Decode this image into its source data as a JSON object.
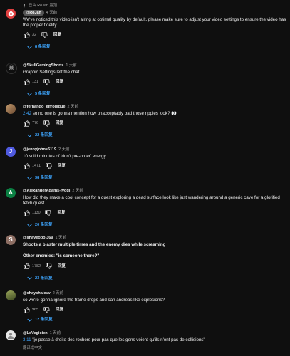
{
  "comments": [
    {
      "pinned_label": "已由 RoJan 置顶",
      "author": "@RoJan",
      "owner": true,
      "time": "4 天前",
      "text": "We've noticed this video isn't airing at optimal quality by default, please make sure to adjust your video settings to ensure the video has the proper fidelity.",
      "likes": "32",
      "reply_label": "回复",
      "replies": "8 条回复",
      "avatar_color": "#e04040",
      "avatar_letter": ""
    },
    {
      "author": "@SkullGamingShorts",
      "time": "1 天前",
      "text": "Graphic Settings left the chat...",
      "likes": "131",
      "reply_label": "回复",
      "replies": "5 条回复",
      "avatar_color": "#f1f1f1",
      "avatar_letter": "☠"
    },
    {
      "author": "@fernando_elfrodique",
      "time": "2 天前",
      "timestamp": "2:42",
      "text": " so no one is gonna mention how unacceptably bad those ripples look? 👀",
      "likes": "776",
      "reply_label": "回复",
      "replies": "22 条回复",
      "avatar_color": "#a47a55",
      "avatar_letter": ""
    },
    {
      "author": "@jennyjohns5119",
      "time": "2 天前",
      "text": "10 solid minutes of 'don't pre-order' energy.",
      "likes": "1471",
      "reply_label": "回复",
      "replies": "38 条回复",
      "avatar_color": "#4f5ae0",
      "avatar_letter": "J"
    },
    {
      "author": "@AlexanderAdams-fvdgl",
      "time": "2 天前",
      "text": "How did they make a cool concept for a quest exploring a dead surface look like just wandering around a generic cave for a glorified fetch quest",
      "likes": "1130",
      "reply_label": "回复",
      "replies": "20 条回复",
      "avatar_color": "#0b8043",
      "avatar_letter": "A"
    },
    {
      "author": "@shayeoboi369",
      "time": "1 天前",
      "text": "Shoots a blaster multiple times and the enemy dies while screaming\n\nOther enemies: \"is someone there?\"",
      "bold": true,
      "likes": "1782",
      "reply_label": "回复",
      "replies": "23 条回复",
      "avatar_color": "#8d6e63",
      "avatar_letter": "S"
    },
    {
      "author": "@shayshalevv",
      "time": "2 天前",
      "text": "so we're gonna ignore the frame drops and san andreas like explosions?",
      "likes": "965",
      "reply_label": "回复",
      "replies": "12 条回复",
      "avatar_color": "#6b7d3a",
      "avatar_letter": ""
    },
    {
      "author": "@LeVegicien",
      "time": "1 天前",
      "timestamp": "3:11",
      "text": " \"je passe à droite des rochers pour pas que les gens voient qu'ils n'ont pas de collisions\"",
      "translate_label": "翻译成中文",
      "avatar_color": "#e8e8e8",
      "avatar_letter": ""
    }
  ]
}
